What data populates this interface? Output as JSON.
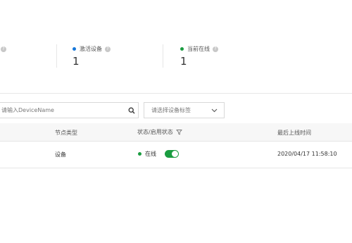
{
  "stats": [
    {
      "label": "",
      "value": "",
      "dot_color": "#ffffff",
      "icon": "help-icon"
    },
    {
      "label": "激活设备",
      "value": "1",
      "dot_color": "#1677d9",
      "icon": "help-icon"
    },
    {
      "label": "当前在线",
      "value": "1",
      "dot_color": "#1a9c40",
      "icon": "help-icon"
    }
  ],
  "help_icon_glyph": "?",
  "search": {
    "placeholder": "请输入DeviceName",
    "value": "",
    "icon": "search-icon"
  },
  "tag_select": {
    "placeholder": "请选择设备标签",
    "icon": "chevron-down-icon"
  },
  "table": {
    "headers": {
      "node_type": "节点类型",
      "status": "状态/启用状态",
      "last_online": "最后上线时间"
    },
    "filter_icon": "filter-icon",
    "rows": [
      {
        "node_type": "设备",
        "status_text": "在线",
        "status_color": "#1a9c40",
        "enabled": true,
        "last_online": "2020/04/17 11:58:10"
      }
    ]
  },
  "colors": {
    "accent_blue": "#1677d9",
    "online_green": "#1a9c40"
  }
}
